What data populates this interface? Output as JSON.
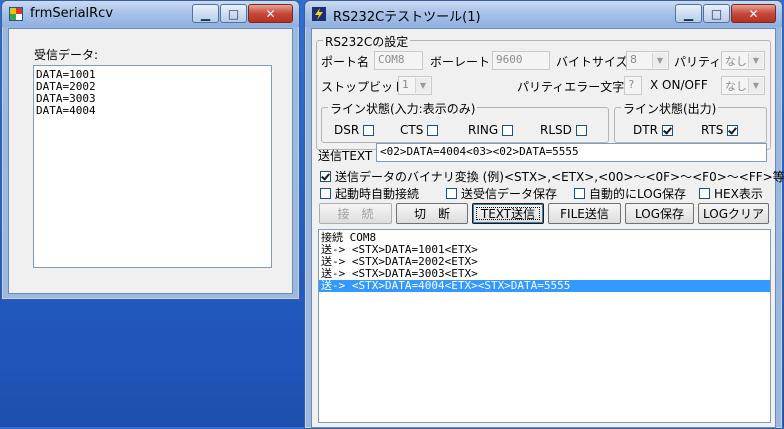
{
  "win1": {
    "title": "frmSerialRcv",
    "recv_label": "受信データ:",
    "lines": [
      "DATA=1001",
      "DATA=2002",
      "DATA=3003",
      "DATA=4004"
    ]
  },
  "win2": {
    "title": "RS232Cテストツール(1)",
    "settings": {
      "group_title": "RS232Cの設定",
      "port_label": "ポート名",
      "port_value": "COM8",
      "baud_label": "ボーレート",
      "baud_value": "9600",
      "bytesize_label": "バイトサイズ",
      "bytesize_value": "8",
      "parity_label": "パリティ",
      "parity_value": "なし",
      "stopbit_label": "ストップビット",
      "stopbit_value": "1",
      "parityerr_label": "パリティエラー文字",
      "parityerr_value": "?",
      "xonoff_label": "X ON/OFF",
      "xonoff_value": "なし"
    },
    "line_in": {
      "title": "ライン状態(入力:表示のみ)",
      "dsr": "DSR",
      "cts": "CTS",
      "ring": "RING",
      "rlsd": "RLSD"
    },
    "line_out": {
      "title": "ライン状態(出力)",
      "dtr": "DTR",
      "rts": "RTS"
    },
    "send_text_label": "送信TEXT",
    "send_text_value": "<02>DATA=4004<03><02>DATA=5555",
    "options": {
      "binary": "送信データのバイナリ変換 (例)<STX>,<ETX>,<00>～<0F>～<F0>～<FF>等",
      "autoconnect": "起動時自動接続",
      "savedata": "送受信データ保存",
      "autolog": "自動的にLOG保存",
      "hex": "HEX表示"
    },
    "buttons": {
      "connect": "接　続",
      "disconnect": "切　断",
      "text_send": "TEXT送信",
      "file_send": "FILE送信",
      "log_save": "LOG保存",
      "log_clear": "LOGクリア"
    },
    "log": [
      "接続 COM8",
      "送-> <STX>DATA=1001<ETX>",
      "送-> <STX>DATA=2002<ETX>",
      "送-> <STX>DATA=3003<ETX>",
      "送-> <STX>DATA=4004<ETX><STX>DATA=5555"
    ]
  }
}
